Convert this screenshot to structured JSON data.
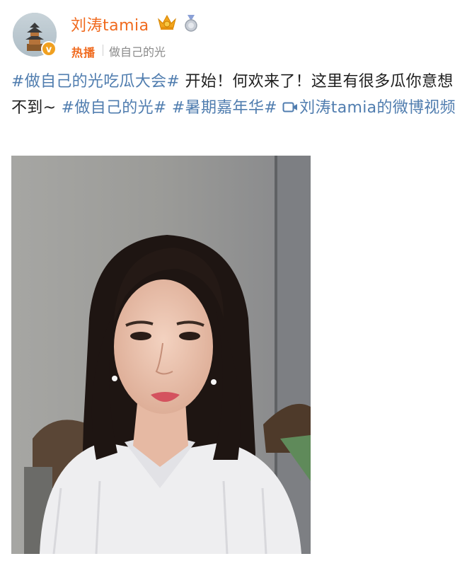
{
  "user": {
    "name": "刘涛tamia",
    "hot_label": "热播",
    "source": "做自己的光"
  },
  "post": {
    "tag1": "#做自己的光吃瓜大会#",
    "text1": " 开始！何欢来了！这里有很多瓜你意想不到~ ",
    "tag2": "#做自己的光#",
    "tag3": "#暑期嘉年华#",
    "video_link": "刘涛tamia的微博视频"
  },
  "icons": {
    "avatar": "tower-avatar",
    "verified": "verified-badge-icon",
    "crown": "crown-icon",
    "medal": "medal-icon",
    "video": "video-icon"
  },
  "colors": {
    "username": "#f06a1e",
    "topic_link": "#507daf"
  }
}
